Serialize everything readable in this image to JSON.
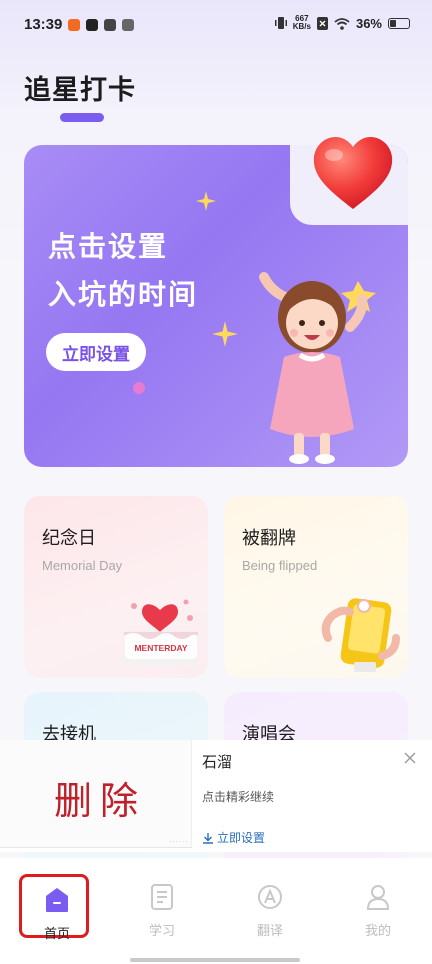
{
  "status_bar": {
    "time": "13:39",
    "net_speed_value": "667",
    "net_speed_unit": "KB/s",
    "battery": "36%"
  },
  "header": {
    "title": "追星打卡"
  },
  "banner": {
    "line1": "点击设置",
    "line2": "入坑的时间",
    "button": "立即设置"
  },
  "cards": [
    {
      "title": "纪念日",
      "subtitle": "Memorial Day"
    },
    {
      "title": "被翻牌",
      "subtitle": "Being flipped"
    },
    {
      "title": "去接机"
    },
    {
      "title": "演唱会"
    }
  ],
  "memorial_cake_text": "MENTERDAY",
  "ad": {
    "thumb_text": "删除",
    "name": "石溜",
    "description": "点击精彩继续",
    "action": "立即设置"
  },
  "bottom_nav": [
    {
      "label": "首页",
      "icon": "home-icon",
      "active": true
    },
    {
      "label": "学习",
      "icon": "document-icon",
      "active": false
    },
    {
      "label": "翻译",
      "icon": "translate-icon",
      "active": false
    },
    {
      "label": "我的",
      "icon": "profile-icon",
      "active": false
    }
  ],
  "colors": {
    "accent": "#7a5cf0",
    "highlight_box": "#e01b1b",
    "ad_link": "#2a6fbf"
  }
}
